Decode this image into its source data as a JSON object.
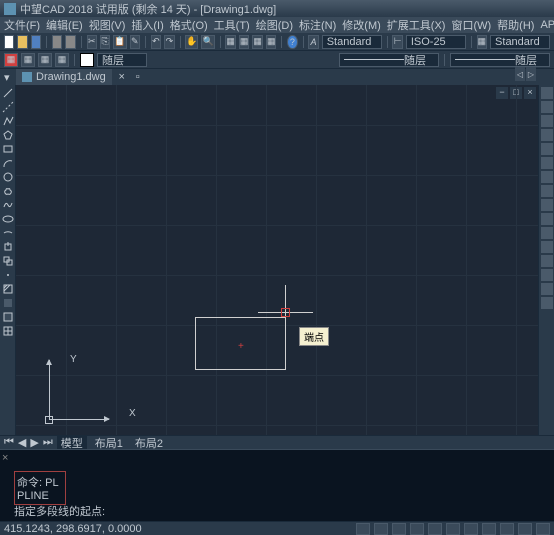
{
  "titlebar": {
    "text": "中望CAD 2018 试用版 (剩余 14 天) - [Drawing1.dwg]"
  },
  "menu": {
    "items": [
      "文件(F)",
      "编辑(E)",
      "视图(V)",
      "插入(I)",
      "格式(O)",
      "工具(T)",
      "绘图(D)",
      "标注(N)",
      "修改(M)",
      "扩展工具(X)",
      "窗口(W)",
      "帮助(H)",
      "APP+"
    ]
  },
  "toolbar1": {
    "style": "Standard",
    "dim": "ISO-25",
    "textstyle": "Standard"
  },
  "toolbar2": {
    "layer": "随层"
  },
  "doctab": {
    "name": "Drawing1.dwg"
  },
  "canvas": {
    "tooltip": "端点",
    "ucs": {
      "x": "X",
      "y": "Y"
    }
  },
  "modeltabs": {
    "tabs": [
      "模型",
      "布局1",
      "布局2"
    ],
    "active": 0
  },
  "command": {
    "history": [
      "命令: PL",
      "PLINE"
    ],
    "prompt": "指定多段线的起点:"
  },
  "statusbar": {
    "coords": "415.1243, 298.6917, 0.0000"
  },
  "icons": {
    "new": "□",
    "open": "📁",
    "save": "💾",
    "cut": "✂",
    "copy": "⎘",
    "paste": "📋",
    "undo": "↶",
    "redo": "↷",
    "pan": "✋",
    "print": "⎙"
  }
}
